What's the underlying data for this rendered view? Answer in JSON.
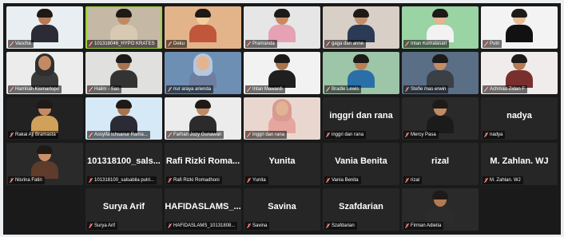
{
  "colors": {
    "speaking_outline": "#9fd23a",
    "mic_muted": "#e53935"
  },
  "tiles": [
    {
      "name": "Vascha",
      "kind": "video",
      "bg": "#e8eef2",
      "skin": "#b87b55",
      "top": "#2b2b35"
    },
    {
      "name": "101318046_HYPO KRATES",
      "kind": "video",
      "bg": "#c5b9a6",
      "skin": "#c08a63",
      "top": "#d8c9b3"
    },
    {
      "name": "Deku",
      "kind": "video",
      "bg": "#e3b48a",
      "skin": "#f3cf9c",
      "top": "#c0563a"
    },
    {
      "name": "Pramanda",
      "kind": "video",
      "bg": "#e6e6e6",
      "skin": "#c98a62",
      "top": "#e6a1b5"
    },
    {
      "name": "gaga dan anne",
      "kind": "video",
      "bg": "#d8cfc7",
      "skin": "#c28f6a",
      "top": "#2b3a55"
    },
    {
      "name": "Intan Kumalasari",
      "kind": "video",
      "bg": "#9ad3a4",
      "skin": "#e4b38f",
      "top": "#f2f2f2"
    },
    {
      "name": "Putri",
      "kind": "video",
      "bg": "#f3f3f3",
      "skin": "#e9bd94",
      "top": "#111111"
    },
    {
      "name": "Harrinah Kismartopo",
      "kind": "video",
      "bg": "#ececec",
      "skin": "#c48a62",
      "top": "#3a3a3a",
      "hijab": "#2f2f2f"
    },
    {
      "name": "Halim - Sas",
      "kind": "video",
      "bg": "#e0e0de",
      "skin": "#a8744e",
      "top": "#333333"
    },
    {
      "name": "nur araya arienda",
      "kind": "video",
      "bg": "#6e8fb4",
      "skin": "#e3b48f",
      "top": "#6d7ea0",
      "hijab": "#b7c7dd"
    },
    {
      "name": "Intan Mawardi",
      "kind": "video",
      "bg": "#f2f2f2",
      "skin": "#a8744e",
      "top": "#1f1f1f"
    },
    {
      "name": "Bradle Lewis",
      "kind": "video",
      "bg": "#9dc5a8",
      "skin": "#b88058",
      "top": "#2a6fa8"
    },
    {
      "name": "Stefie mas erwin",
      "kind": "video",
      "bg": "#5a6e85",
      "skin": "#c58d66",
      "top": "#3b3f46"
    },
    {
      "name": "Achmad Zidan F",
      "kind": "video",
      "bg": "#f0eceb",
      "skin": "#b67c54",
      "top": "#7a2f2f"
    },
    {
      "name": "Rakai Aji Bramasta",
      "kind": "video",
      "bg": "#222222",
      "skin": "#c48a62",
      "top": "#d0a15a"
    },
    {
      "name": "Assyifa Ichsanur Rama...",
      "kind": "video",
      "bg": "#d6e9f7",
      "skin": "#a8744e",
      "top": "#2b2b35"
    },
    {
      "name": "Farhan Jozy Gunawan",
      "kind": "video",
      "bg": "#ececec",
      "skin": "#c08a63",
      "top": "#2b2b2b"
    },
    {
      "name": "inggri dan rana",
      "kind": "video",
      "bg": "#e9d7cf",
      "skin": "#e2b394",
      "top": "#e5a6a0",
      "hijab": "#d99a92"
    },
    {
      "name": "inggri dan rana",
      "kind": "name",
      "label": "inggri dan rana"
    },
    {
      "name": "Mercy Pasa",
      "kind": "video",
      "bg": "#2a2a2a",
      "skin": "#c48a62",
      "top": "#1b1b1b"
    },
    {
      "name": "nadya",
      "kind": "name",
      "label": "nadya"
    },
    {
      "name": "Nisrina Fatin",
      "kind": "video",
      "bg": "#2a2a2a",
      "skin": "#c98f66",
      "top": "#5e3b2a"
    },
    {
      "name": "101318100_sals...",
      "kind": "name",
      "label": "101318100_salsabila putri..."
    },
    {
      "name": "Rafi Rizki Roma...",
      "kind": "name",
      "label": "Rafi Rizki Romadhoni"
    },
    {
      "name": "Yunita",
      "kind": "name",
      "label": "Yunita"
    },
    {
      "name": "Vania Benita",
      "kind": "name",
      "label": "Vania Benita"
    },
    {
      "name": "rizal",
      "kind": "name",
      "label": "rizal"
    },
    {
      "name": "M. Zahlan. WJ",
      "kind": "name",
      "label": "M. Zahlan. WJ"
    },
    {
      "name": "",
      "kind": "empty"
    },
    {
      "name": "Surya Arif",
      "kind": "name",
      "label": "Surya Arif"
    },
    {
      "name": "HAFIDASLAMS_...",
      "kind": "name",
      "label": "HAFIDASLAMS_10131808..."
    },
    {
      "name": "Savina",
      "kind": "name",
      "label": "Savina"
    },
    {
      "name": "Szafdarian",
      "kind": "name",
      "label": "Szafdarian"
    },
    {
      "name": "Firman Adietia",
      "kind": "video",
      "bg": "#2a2a2a",
      "skin": "#b57a52",
      "top": "#2c2c2c"
    },
    {
      "name": "",
      "kind": "empty"
    }
  ]
}
